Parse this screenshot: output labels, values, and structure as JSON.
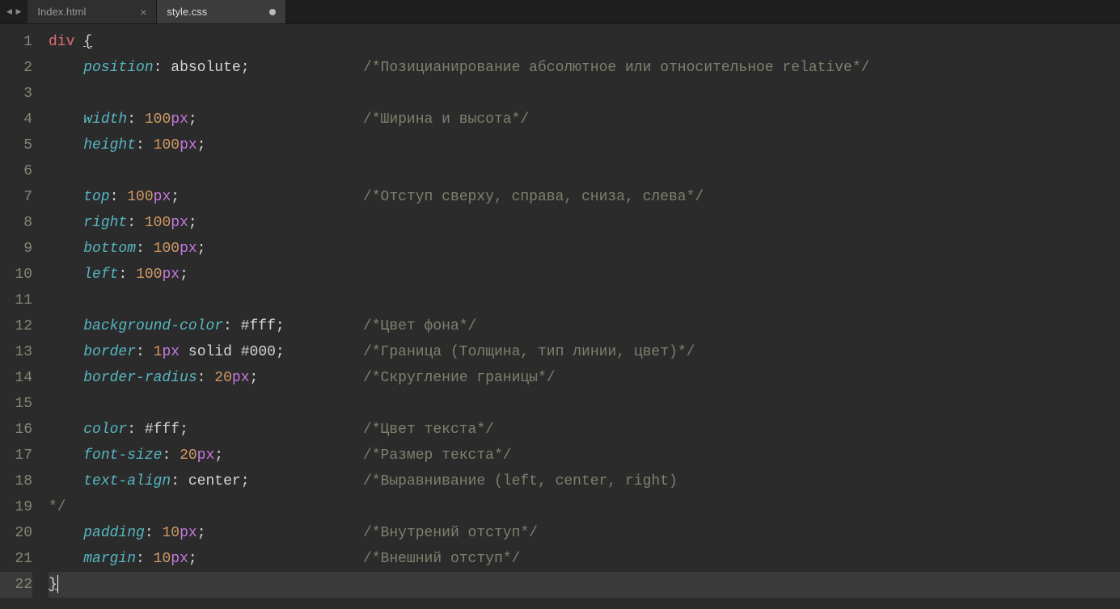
{
  "tabs": [
    {
      "label": "Index.html",
      "active": false,
      "dirty": false
    },
    {
      "label": "style.css",
      "active": true,
      "dirty": true
    }
  ],
  "nav": {
    "left": "◄",
    "right": "►"
  },
  "lineCount": 22,
  "activeLine": 22,
  "code": {
    "l1": {
      "sel": "div",
      "brace": "{"
    },
    "l2": {
      "prop": "position",
      "val": "absolute",
      "comment": "/*Позицианирование абсолютное или относительное relative*/"
    },
    "l4": {
      "prop": "width",
      "num": "100",
      "unit": "px",
      "comment": "/*Ширина и высота*/"
    },
    "l5": {
      "prop": "height",
      "num": "100",
      "unit": "px"
    },
    "l7": {
      "prop": "top",
      "num": "100",
      "unit": "px",
      "comment": "/*Отступ сверху, справа, сниза, слева*/"
    },
    "l8": {
      "prop": "right",
      "num": "100",
      "unit": "px"
    },
    "l9": {
      "prop": "bottom",
      "num": "100",
      "unit": "px"
    },
    "l10": {
      "prop": "left",
      "num": "100",
      "unit": "px"
    },
    "l12": {
      "prop": "background-color",
      "hex": "#fff",
      "comment": "/*Цвет фона*/"
    },
    "l13": {
      "prop": "border",
      "num": "1",
      "unit": "px",
      "val2": "solid",
      "hex": "#000",
      "comment": "/*Граница (Толщина, тип линии, цвет)*/"
    },
    "l14": {
      "prop": "border-radius",
      "num": "20",
      "unit": "px",
      "comment": "/*Скругление границы*/"
    },
    "l16": {
      "prop": "color",
      "hex": "#fff",
      "comment": "/*Цвет текста*/"
    },
    "l17": {
      "prop": "font-size",
      "num": "20",
      "unit": "px",
      "comment": "/*Размер текста*/"
    },
    "l18": {
      "prop": "text-align",
      "val": "center",
      "comment": "/*Выравнивание (left, center, right)"
    },
    "l19": {
      "comment": "*/"
    },
    "l20": {
      "prop": "padding",
      "num": "10",
      "unit": "px",
      "comment": "/*Внутрений отступ*/"
    },
    "l21": {
      "prop": "margin",
      "num": "10",
      "unit": "px",
      "comment": "/*Внешний отступ*/"
    },
    "l22": {
      "brace": "}"
    }
  },
  "commentCol": 36
}
